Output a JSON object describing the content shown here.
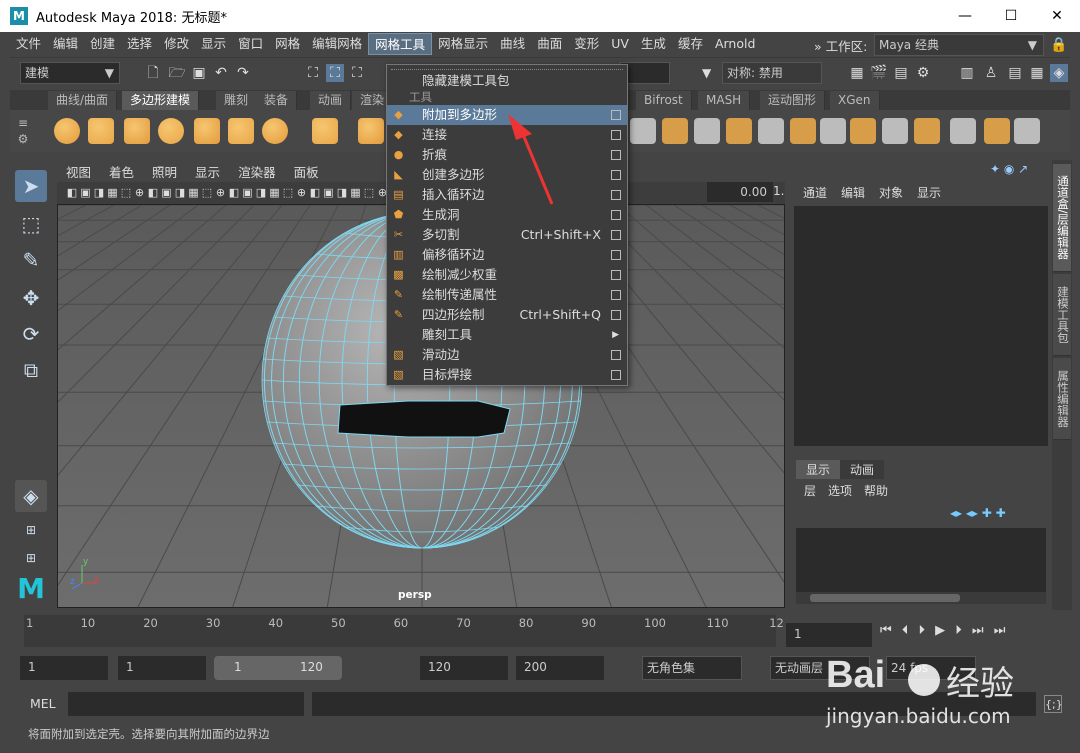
{
  "window": {
    "logo": "M",
    "title": "Autodesk Maya 2018: 无标题*",
    "min": "—",
    "max": "☐",
    "close": "✕"
  },
  "menubar": [
    "文件",
    "编辑",
    "创建",
    "选择",
    "修改",
    "显示",
    "窗口",
    "网格",
    "编辑网格",
    "网格工具",
    "网格显示",
    "曲线",
    "曲面",
    "变形",
    "UV",
    "生成",
    "缓存",
    "Arnold"
  ],
  "workspace": {
    "label": "工作区:",
    "value": "Maya 经典"
  },
  "statusline": {
    "mode": "建模",
    "symmetry": "对称: 禁用"
  },
  "shelf_tabs": [
    "曲线/曲面",
    "多边形建模",
    "雕刻",
    "装备",
    "动画",
    "渲染",
    "Bifrost",
    "MASH",
    "运动图形",
    "XGen"
  ],
  "shelf_active": "多边形建模",
  "viewport": {
    "menus": [
      "视图",
      "着色",
      "照明",
      "显示",
      "渲染器",
      "面板"
    ],
    "exposure": "0.00",
    "gamma": "1.",
    "camera": "persp",
    "axes": {
      "y": "y",
      "x": "x",
      "z": "z"
    }
  },
  "dropdown": {
    "hide_label": "隐藏建模工具包",
    "section": "工具",
    "items": [
      {
        "label": "附加到多边形",
        "shortcut": "",
        "kind": "box",
        "highlight": true
      },
      {
        "label": "连接",
        "shortcut": "",
        "kind": "box"
      },
      {
        "label": "折痕",
        "shortcut": "",
        "kind": "box"
      },
      {
        "label": "创建多边形",
        "shortcut": "",
        "kind": "box"
      },
      {
        "label": "插入循环边",
        "shortcut": "",
        "kind": "box"
      },
      {
        "label": "生成洞",
        "shortcut": "",
        "kind": "box"
      },
      {
        "label": "多切割",
        "shortcut": "Ctrl+Shift+X",
        "kind": "box"
      },
      {
        "label": "偏移循环边",
        "shortcut": "",
        "kind": "box"
      },
      {
        "label": "绘制减少权重",
        "shortcut": "",
        "kind": "box"
      },
      {
        "label": "绘制传递属性",
        "shortcut": "",
        "kind": "box"
      },
      {
        "label": "四边形绘制",
        "shortcut": "Ctrl+Shift+Q",
        "kind": "box"
      },
      {
        "label": "雕刻工具",
        "shortcut": "",
        "kind": "arrow"
      },
      {
        "label": "滑动边",
        "shortcut": "",
        "kind": "box"
      },
      {
        "label": "目标焊接",
        "shortcut": "",
        "kind": "box"
      }
    ]
  },
  "channelbox": {
    "menus": [
      "通道",
      "编辑",
      "对象",
      "显示"
    ]
  },
  "layereditor": {
    "tabs": [
      "显示",
      "动画"
    ],
    "menus": [
      "层",
      "选项",
      "帮助"
    ]
  },
  "side_tabs": [
    "通道盒/层编辑器",
    "建模工具包",
    "属性编辑器"
  ],
  "timeline": {
    "ticks": [
      "1",
      "10",
      "20",
      "30",
      "40",
      "50",
      "60",
      "70",
      "80",
      "90",
      "100",
      "110",
      "12"
    ],
    "current_frame": "1"
  },
  "range": {
    "start": "1",
    "anim_start": "1",
    "slider_start": "1",
    "slider_end": "120",
    "end": "120",
    "anim_end": "200",
    "charset": "无角色集",
    "animlayer": "无动画层",
    "fps": "24 fps"
  },
  "cmd": {
    "label": "MEL"
  },
  "help": "将面附加到选定壳。选择要向其附加面的边界边",
  "watermark": {
    "brand": "Bai",
    "brand2": "经验",
    "url": "jingyan.baidu.com"
  }
}
